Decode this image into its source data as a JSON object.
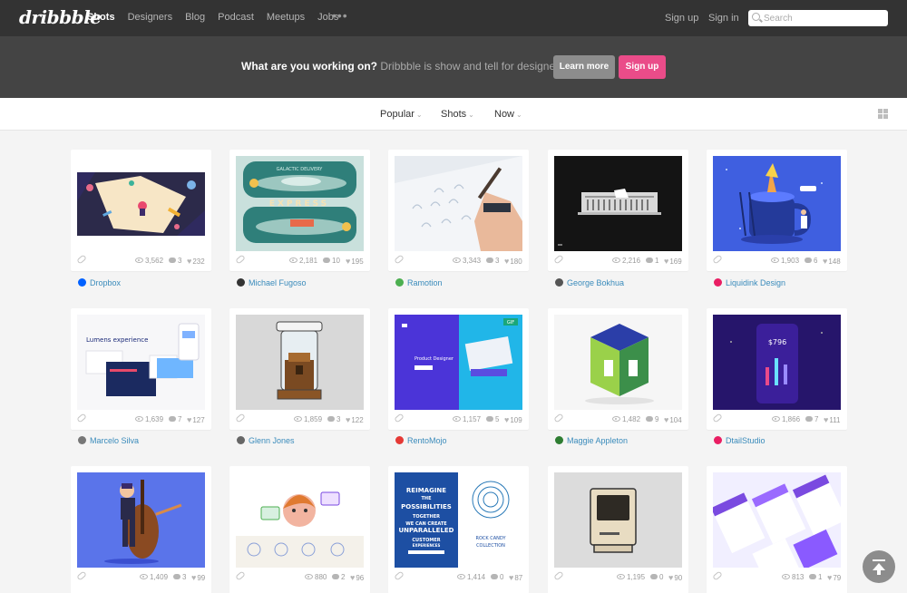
{
  "header": {
    "logo": "dribbble",
    "nav": [
      {
        "label": "Shots",
        "active": true
      },
      {
        "label": "Designers",
        "active": false
      },
      {
        "label": "Blog",
        "active": false
      },
      {
        "label": "Podcast",
        "active": false
      },
      {
        "label": "Meetups",
        "active": false
      },
      {
        "label": "Jobs",
        "active": false
      }
    ],
    "more": "•••",
    "signup": "Sign up",
    "signin": "Sign in",
    "search_placeholder": "Search"
  },
  "promo": {
    "question": "What are you working on?",
    "tagline": "Dribbble is show and tell for designers.",
    "learn_more": "Learn more",
    "sign_up": "Sign up",
    "colors": {
      "sign_up": "#ea4c89",
      "learn_more": "#8d8d8d"
    }
  },
  "filters": {
    "sort": "Popular",
    "type": "Shots",
    "time": "Now"
  },
  "shots": [
    {
      "designer": "Dropbox",
      "views": "3,562",
      "comments": "3",
      "likes": "232",
      "icon_color": "#0061ff",
      "thumb": "dropbox"
    },
    {
      "designer": "Michael Fugoso",
      "views": "2,181",
      "comments": "10",
      "likes": "195",
      "icon_color": "#333333",
      "thumb": "express"
    },
    {
      "designer": "Ramotion",
      "views": "3,343",
      "comments": "3",
      "likes": "180",
      "icon_color": "#4caf50",
      "thumb": "sketch"
    },
    {
      "designer": "George Bokhua",
      "views": "2,216",
      "comments": "1",
      "likes": "169",
      "icon_color": "#555555",
      "thumb": "building"
    },
    {
      "designer": "Liquidink Design",
      "views": "1,903",
      "comments": "6",
      "likes": "148",
      "icon_color": "#e91e63",
      "thumb": "cup"
    },
    {
      "designer": "Marcelo Silva",
      "views": "1,639",
      "comments": "7",
      "likes": "127",
      "icon_color": "#777777",
      "thumb": "lumens"
    },
    {
      "designer": "Glenn Jones",
      "views": "1,859",
      "comments": "3",
      "likes": "122",
      "icon_color": "#666666",
      "thumb": "jar"
    },
    {
      "designer": "RentoMojo",
      "views": "1,157",
      "comments": "5",
      "likes": "109",
      "icon_color": "#e53935",
      "thumb": "product"
    },
    {
      "designer": "Maggie Appleton",
      "views": "1,482",
      "comments": "9",
      "likes": "104",
      "icon_color": "#2e7d32",
      "thumb": "cube"
    },
    {
      "designer": "DtailStudio",
      "views": "1,866",
      "comments": "7",
      "likes": "111",
      "icon_color": "#e91e63",
      "thumb": "phone"
    },
    {
      "designer": "",
      "views": "1,409",
      "comments": "3",
      "likes": "99",
      "icon_color": "",
      "thumb": "cello"
    },
    {
      "designer": "",
      "views": "880",
      "comments": "2",
      "likes": "96",
      "icon_color": "",
      "thumb": "face"
    },
    {
      "designer": "",
      "views": "1,414",
      "comments": "0",
      "likes": "87",
      "icon_color": "",
      "thumb": "reimagine"
    },
    {
      "designer": "",
      "views": "1,195",
      "comments": "0",
      "likes": "90",
      "icon_color": "",
      "thumb": "mac"
    },
    {
      "designer": "",
      "views": "813",
      "comments": "1",
      "likes": "79",
      "icon_color": "",
      "thumb": "purple-ui"
    }
  ],
  "thumb_text": {
    "express": "EXPRESS",
    "galactic": "GALACTIC DELIVERY",
    "lumens": "Lumens experience",
    "product": "Product Designer",
    "gif": "GIF",
    "phone": "$796",
    "reimagine": [
      "REIMAGINE",
      "THE",
      "POSSIBILITIES",
      "TOGETHER",
      "WE CAN CREATE",
      "UNPARALLELED",
      "CUSTOMER",
      "EXPERIENCES"
    ],
    "rockcandy": [
      "ROCK CANDY",
      "COLLECTION"
    ]
  }
}
